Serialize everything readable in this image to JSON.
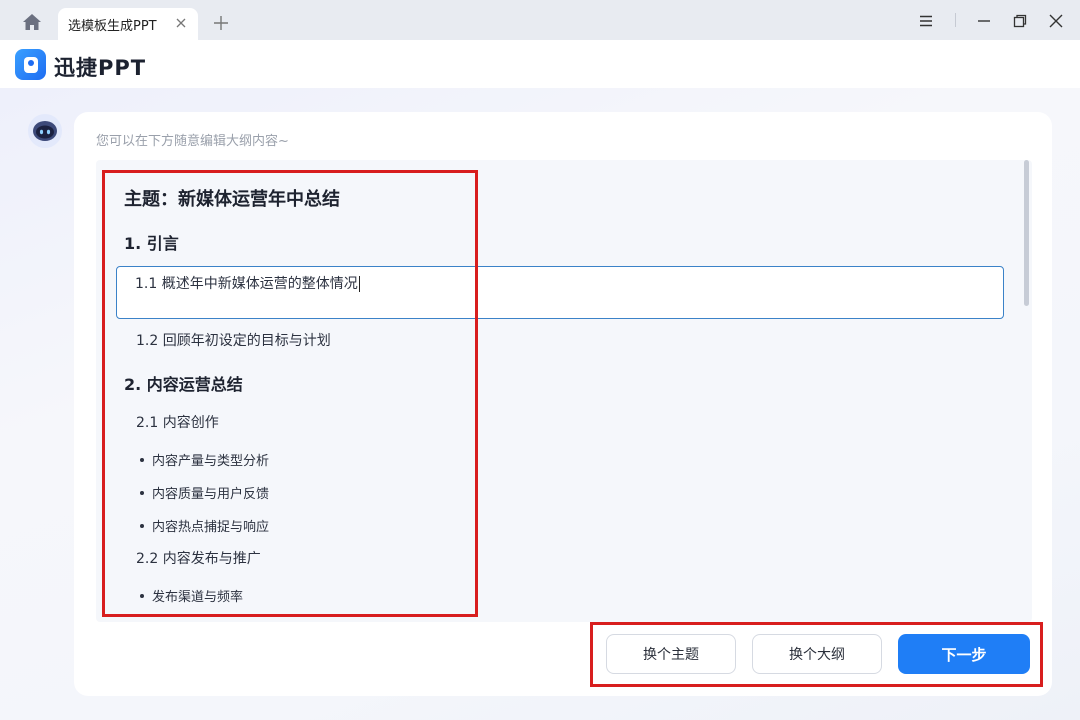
{
  "titlebar": {
    "tab_label": "选模板生成PPT"
  },
  "app": {
    "brand_prefix": "迅捷",
    "brand_suffix": "PPT"
  },
  "card": {
    "hint": "您可以在下方随意编辑大纲内容~"
  },
  "outline": {
    "title": "主题：新媒体运营年中总结",
    "sections": [
      {
        "heading": "1. 引言",
        "items": [
          {
            "label": "1.1  概述年中新媒体运营的整体情况"
          },
          {
            "label": "1.2  回顾年初设定的目标与计划"
          }
        ]
      },
      {
        "heading": "2. 内容运营总结",
        "items": [
          {
            "label": "2.1  内容创作",
            "bullets": [
              "内容产量与类型分析",
              "内容质量与用户反馈",
              "内容热点捕捉与响应"
            ]
          },
          {
            "label": "2.2  内容发布与推广",
            "bullets": [
              "发布渠道与频率"
            ]
          }
        ]
      }
    ]
  },
  "buttons": {
    "change_theme": "换个主题",
    "change_outline": "换个大纲",
    "next": "下一步"
  },
  "colors": {
    "accent": "#1f7ef6",
    "annotation": "#d81e1e"
  }
}
